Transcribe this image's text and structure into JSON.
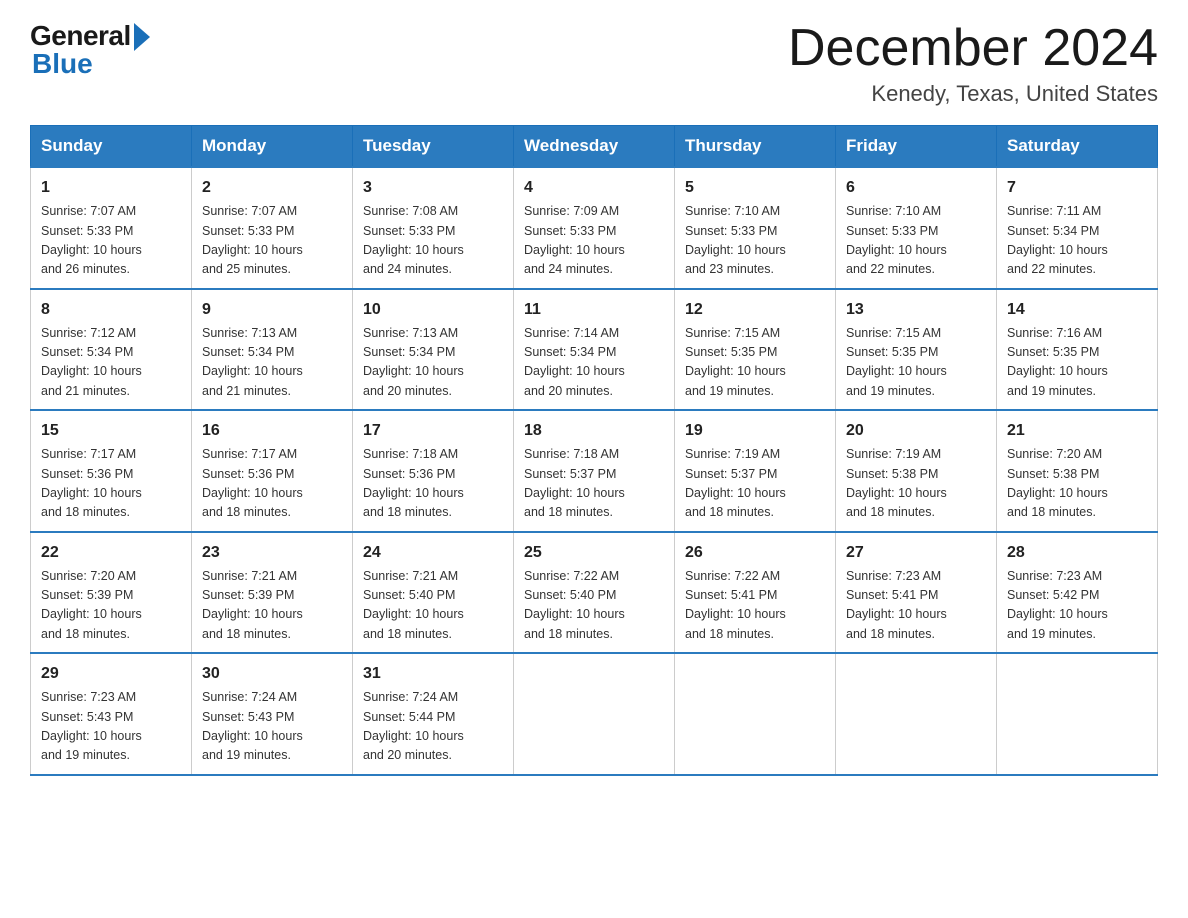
{
  "header": {
    "logo_general": "General",
    "logo_blue": "Blue",
    "title": "December 2024",
    "location": "Kenedy, Texas, United States"
  },
  "days_of_week": [
    "Sunday",
    "Monday",
    "Tuesday",
    "Wednesday",
    "Thursday",
    "Friday",
    "Saturday"
  ],
  "weeks": [
    [
      {
        "day": "1",
        "info": "Sunrise: 7:07 AM\nSunset: 5:33 PM\nDaylight: 10 hours\nand 26 minutes."
      },
      {
        "day": "2",
        "info": "Sunrise: 7:07 AM\nSunset: 5:33 PM\nDaylight: 10 hours\nand 25 minutes."
      },
      {
        "day": "3",
        "info": "Sunrise: 7:08 AM\nSunset: 5:33 PM\nDaylight: 10 hours\nand 24 minutes."
      },
      {
        "day": "4",
        "info": "Sunrise: 7:09 AM\nSunset: 5:33 PM\nDaylight: 10 hours\nand 24 minutes."
      },
      {
        "day": "5",
        "info": "Sunrise: 7:10 AM\nSunset: 5:33 PM\nDaylight: 10 hours\nand 23 minutes."
      },
      {
        "day": "6",
        "info": "Sunrise: 7:10 AM\nSunset: 5:33 PM\nDaylight: 10 hours\nand 22 minutes."
      },
      {
        "day": "7",
        "info": "Sunrise: 7:11 AM\nSunset: 5:34 PM\nDaylight: 10 hours\nand 22 minutes."
      }
    ],
    [
      {
        "day": "8",
        "info": "Sunrise: 7:12 AM\nSunset: 5:34 PM\nDaylight: 10 hours\nand 21 minutes."
      },
      {
        "day": "9",
        "info": "Sunrise: 7:13 AM\nSunset: 5:34 PM\nDaylight: 10 hours\nand 21 minutes."
      },
      {
        "day": "10",
        "info": "Sunrise: 7:13 AM\nSunset: 5:34 PM\nDaylight: 10 hours\nand 20 minutes."
      },
      {
        "day": "11",
        "info": "Sunrise: 7:14 AM\nSunset: 5:34 PM\nDaylight: 10 hours\nand 20 minutes."
      },
      {
        "day": "12",
        "info": "Sunrise: 7:15 AM\nSunset: 5:35 PM\nDaylight: 10 hours\nand 19 minutes."
      },
      {
        "day": "13",
        "info": "Sunrise: 7:15 AM\nSunset: 5:35 PM\nDaylight: 10 hours\nand 19 minutes."
      },
      {
        "day": "14",
        "info": "Sunrise: 7:16 AM\nSunset: 5:35 PM\nDaylight: 10 hours\nand 19 minutes."
      }
    ],
    [
      {
        "day": "15",
        "info": "Sunrise: 7:17 AM\nSunset: 5:36 PM\nDaylight: 10 hours\nand 18 minutes."
      },
      {
        "day": "16",
        "info": "Sunrise: 7:17 AM\nSunset: 5:36 PM\nDaylight: 10 hours\nand 18 minutes."
      },
      {
        "day": "17",
        "info": "Sunrise: 7:18 AM\nSunset: 5:36 PM\nDaylight: 10 hours\nand 18 minutes."
      },
      {
        "day": "18",
        "info": "Sunrise: 7:18 AM\nSunset: 5:37 PM\nDaylight: 10 hours\nand 18 minutes."
      },
      {
        "day": "19",
        "info": "Sunrise: 7:19 AM\nSunset: 5:37 PM\nDaylight: 10 hours\nand 18 minutes."
      },
      {
        "day": "20",
        "info": "Sunrise: 7:19 AM\nSunset: 5:38 PM\nDaylight: 10 hours\nand 18 minutes."
      },
      {
        "day": "21",
        "info": "Sunrise: 7:20 AM\nSunset: 5:38 PM\nDaylight: 10 hours\nand 18 minutes."
      }
    ],
    [
      {
        "day": "22",
        "info": "Sunrise: 7:20 AM\nSunset: 5:39 PM\nDaylight: 10 hours\nand 18 minutes."
      },
      {
        "day": "23",
        "info": "Sunrise: 7:21 AM\nSunset: 5:39 PM\nDaylight: 10 hours\nand 18 minutes."
      },
      {
        "day": "24",
        "info": "Sunrise: 7:21 AM\nSunset: 5:40 PM\nDaylight: 10 hours\nand 18 minutes."
      },
      {
        "day": "25",
        "info": "Sunrise: 7:22 AM\nSunset: 5:40 PM\nDaylight: 10 hours\nand 18 minutes."
      },
      {
        "day": "26",
        "info": "Sunrise: 7:22 AM\nSunset: 5:41 PM\nDaylight: 10 hours\nand 18 minutes."
      },
      {
        "day": "27",
        "info": "Sunrise: 7:23 AM\nSunset: 5:41 PM\nDaylight: 10 hours\nand 18 minutes."
      },
      {
        "day": "28",
        "info": "Sunrise: 7:23 AM\nSunset: 5:42 PM\nDaylight: 10 hours\nand 19 minutes."
      }
    ],
    [
      {
        "day": "29",
        "info": "Sunrise: 7:23 AM\nSunset: 5:43 PM\nDaylight: 10 hours\nand 19 minutes."
      },
      {
        "day": "30",
        "info": "Sunrise: 7:24 AM\nSunset: 5:43 PM\nDaylight: 10 hours\nand 19 minutes."
      },
      {
        "day": "31",
        "info": "Sunrise: 7:24 AM\nSunset: 5:44 PM\nDaylight: 10 hours\nand 20 minutes."
      },
      null,
      null,
      null,
      null
    ]
  ]
}
